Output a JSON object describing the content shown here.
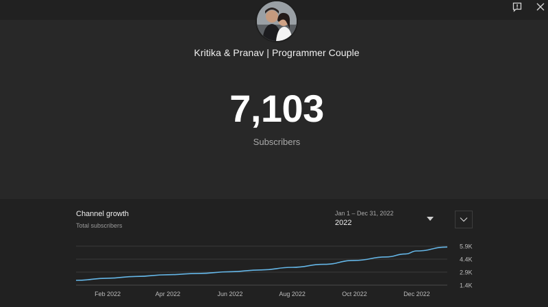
{
  "header": {
    "channel_name": "Kritika & Pranav | Programmer Couple",
    "icons": [
      "report-icon",
      "close-icon"
    ]
  },
  "stats": {
    "count": "7,103",
    "label": "Subscribers"
  },
  "growth": {
    "title": "Channel growth",
    "subtitle": "Total subscribers",
    "date_range": "Jan 1 – Dec 31, 2022",
    "year": "2022"
  },
  "colors": {
    "line": "#65b7e8",
    "background": "#282828",
    "panel": "#212121"
  },
  "chart_data": {
    "type": "line",
    "x_tick_labels": [
      "Feb 2022",
      "Apr 2022",
      "Jun 2022",
      "Aug 2022",
      "Oct 2022",
      "Dec 2022"
    ],
    "x_ticks": [
      "2022-02-01",
      "2022-04-01",
      "2022-06-01",
      "2022-08-01",
      "2022-10-01",
      "2022-12-01"
    ],
    "x_range": [
      "2022-01-01",
      "2022-12-31"
    ],
    "y_tick_labels": [
      "5.9K",
      "4.4K",
      "2.9K",
      "1.4K"
    ],
    "ylim": [
      1400,
      5900
    ],
    "grid": true,
    "series": [
      {
        "x": [
          "2022-01-01",
          "2022-02-01",
          "2022-03-01",
          "2022-04-01",
          "2022-05-01",
          "2022-06-01",
          "2022-07-01",
          "2022-08-01",
          "2022-09-01",
          "2022-10-01",
          "2022-11-01",
          "2022-11-20",
          "2022-12-01",
          "2022-12-31"
        ],
        "values": [
          1950,
          2200,
          2400,
          2600,
          2750,
          2950,
          3150,
          3450,
          3800,
          4250,
          4650,
          5000,
          5350,
          5800
        ]
      }
    ]
  }
}
